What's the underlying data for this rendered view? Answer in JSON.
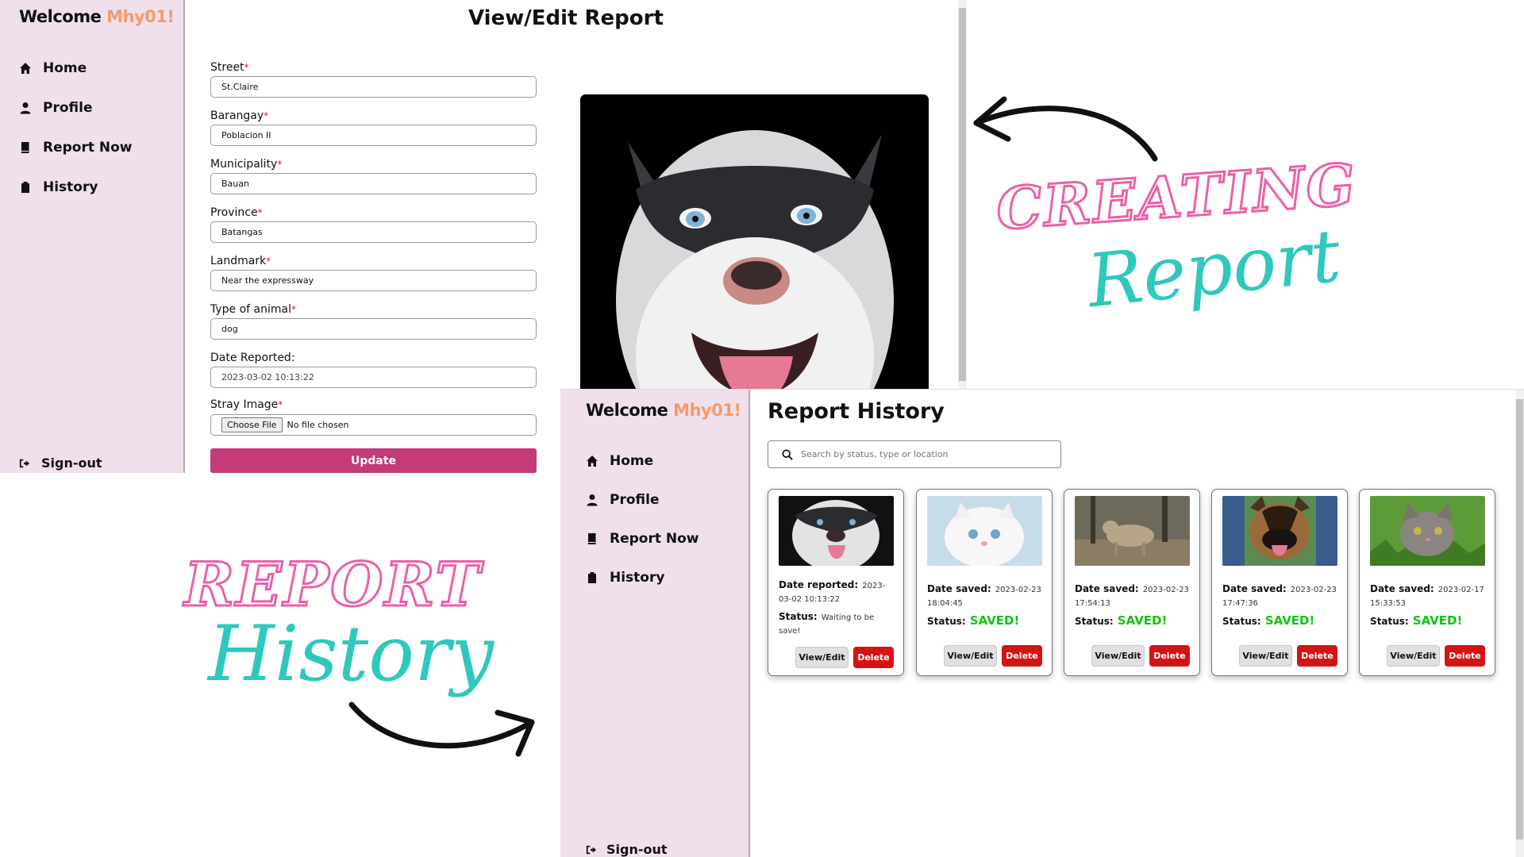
{
  "edit_window": {
    "welcome_prefix": "Welcome ",
    "username": "Mhy01!",
    "nav": [
      "Home",
      "Profile",
      "Report Now",
      "History"
    ],
    "signout": "Sign-out",
    "title": "View/Edit Report",
    "fields": [
      {
        "label": "Street",
        "value": "St.Claire"
      },
      {
        "label": "Barangay",
        "value": "Poblacion II"
      },
      {
        "label": "Municipality",
        "value": "Bauan"
      },
      {
        "label": "Province",
        "value": "Batangas"
      },
      {
        "label": "Landmark",
        "value": "Near the expressway"
      },
      {
        "label": "Type of animal",
        "value": "dog"
      }
    ],
    "required_mark": "*",
    "date_label": "Date Reported:",
    "date_value": "2023-03-02 10:13:22",
    "image_label": "Stray Image",
    "choose_file": "Choose File",
    "no_file": "No file chosen",
    "update": "Update"
  },
  "decor": {
    "creating": "CREATING",
    "report_script": "Report",
    "report_outline": "REPORT",
    "history_script": "History"
  },
  "history_window": {
    "welcome_prefix": "Welcome ",
    "username": "Mhy01!",
    "nav": [
      "Home",
      "Profile",
      "Report Now",
      "History"
    ],
    "signout": "Sign-out",
    "title": "Report History",
    "search_placeholder": "Search by status, type or location",
    "view_edit": "View/Edit",
    "delete": "Delete",
    "cards": [
      {
        "date_label": "Date reported:",
        "date": "2023-03-02 10:13:22",
        "status_label": "Status:",
        "status": "Waiting to be save!"
      },
      {
        "date_label": "Date saved:",
        "date": "2023-02-23 18:04:45",
        "status_label": "Status:",
        "status": "SAVED!"
      },
      {
        "date_label": "Date saved:",
        "date": "2023-02-23 17:54:13",
        "status_label": "Status:",
        "status": "SAVED!"
      },
      {
        "date_label": "Date saved:",
        "date": "2023-02-23 17:47:36",
        "status_label": "Status:",
        "status": "SAVED!"
      },
      {
        "date_label": "Date saved:",
        "date": "2023-02-17 15:33:53",
        "status_label": "Status:",
        "status": "SAVED!"
      }
    ]
  },
  "colors": {
    "sidebar": "#efe0ec",
    "username": "#f59a6b",
    "update_button": "#c33b79",
    "delete_button": "#d41414",
    "saved_status": "#12c412",
    "deco_pink": "#ec5fa8",
    "deco_teal": "#2fc8bc"
  }
}
